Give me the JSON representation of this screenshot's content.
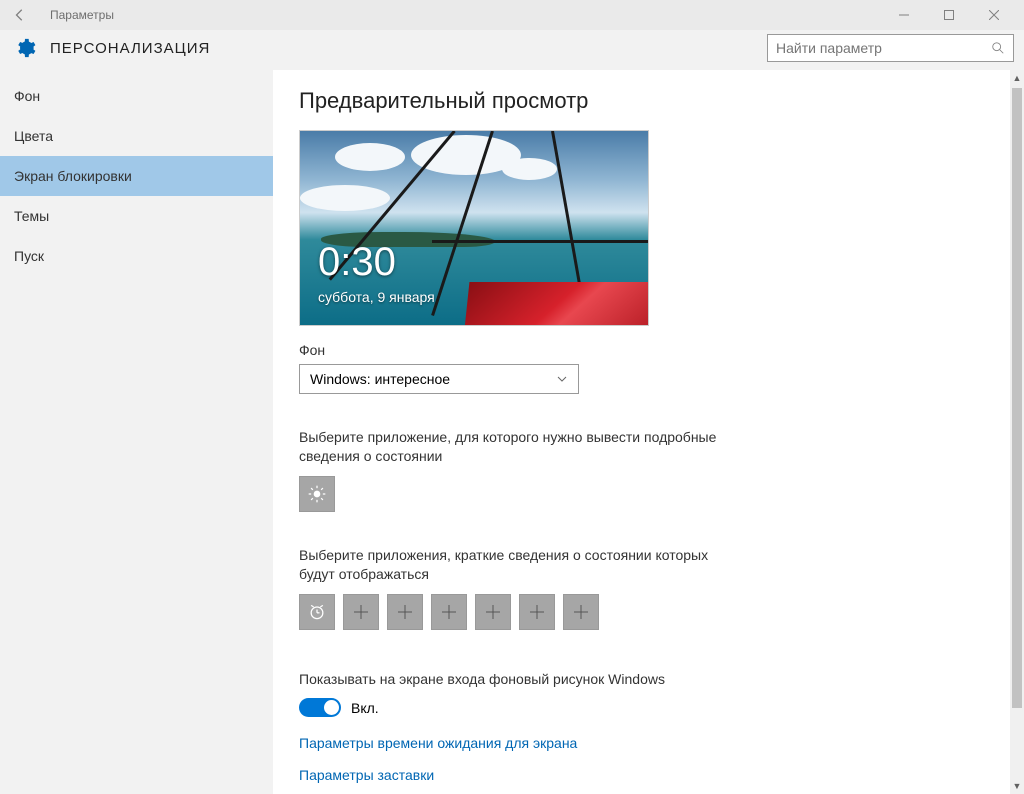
{
  "window": {
    "title": "Параметры"
  },
  "header": {
    "section": "ПЕРСОНАЛИЗАЦИЯ",
    "search_placeholder": "Найти параметр"
  },
  "sidebar": {
    "items": [
      {
        "label": "Фон"
      },
      {
        "label": "Цвета"
      },
      {
        "label": "Экран блокировки"
      },
      {
        "label": "Темы"
      },
      {
        "label": "Пуск"
      }
    ],
    "active_index": 2
  },
  "main": {
    "heading": "Предварительный просмотр",
    "lock_time": "0:30",
    "lock_date": "суббота, 9 января",
    "background_label": "Фон",
    "background_value": "Windows: интересное",
    "detailed_app_text": "Выберите приложение, для которого нужно вывести подробные сведения о состоянии",
    "quick_apps_text": "Выберите приложения, краткие сведения о состоянии которых будут отображаться",
    "show_bg_label": "Показывать на экране входа фоновый рисунок Windows",
    "toggle_state": "Вкл.",
    "link_timeout": "Параметры времени ожидания для экрана",
    "link_screensaver": "Параметры заставки"
  }
}
